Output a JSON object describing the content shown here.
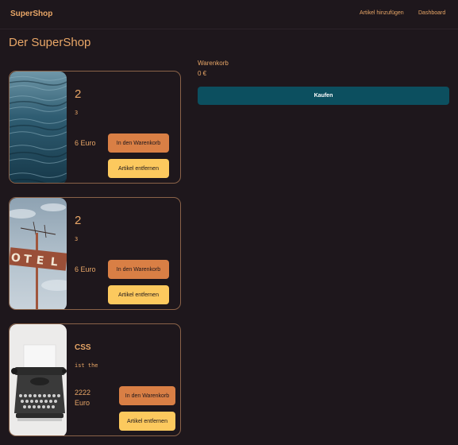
{
  "navbar": {
    "brand": "SuperShop",
    "links": [
      "Artikel hinzufügen",
      "Dashboard"
    ]
  },
  "page": {
    "title": "Der SuperShop"
  },
  "products": [
    {
      "title": "2",
      "description": "3",
      "price": "6 Euro",
      "image": "ocean-water-image",
      "cart_button": "In den Warenkorb",
      "remove_button": "Artikel entfernen"
    },
    {
      "title": "2",
      "description": "3",
      "price": "6 Euro",
      "image": "hotel-sign-image",
      "cart_button": "In den Warenkorb",
      "remove_button": "Artikel entfernen"
    },
    {
      "title": "CSS",
      "description": "ist the",
      "price": "2222 Euro",
      "image": "typewriter-image",
      "cart_button": "In den Warenkorb",
      "remove_button": "Artikel entfernen"
    }
  ],
  "cart": {
    "label": "Warenkorb",
    "total": "0 €",
    "buy_button": "Kaufen"
  },
  "colors": {
    "background": "#1e171c",
    "text": "#e8a667",
    "cart_button": "#d97f45",
    "remove_button": "#fcc95e",
    "buy_button": "#0c4f5f"
  }
}
